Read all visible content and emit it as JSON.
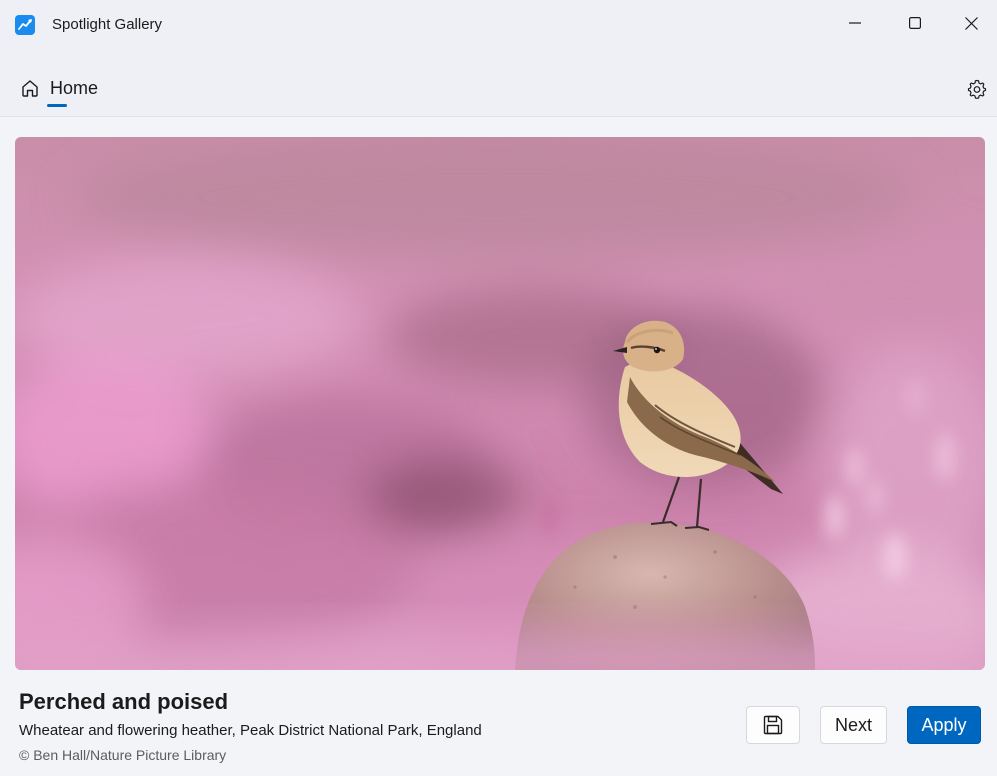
{
  "window": {
    "title": "Spotlight Gallery",
    "minimize_icon": "minimize-icon",
    "maximize_icon": "maximize-icon",
    "close_icon": "close-icon"
  },
  "nav": {
    "home_label": "Home",
    "home_icon": "home-icon",
    "settings_icon": "gear-icon",
    "accent": "#0067c0"
  },
  "image": {
    "title": "Perched and poised",
    "description": "Wheatear and flowering heather, Peak District National Park, England",
    "copyright": "© Ben Hall/Nature Picture Library"
  },
  "actions": {
    "save_icon": "save-icon",
    "next_label": "Next",
    "apply_label": "Apply"
  }
}
